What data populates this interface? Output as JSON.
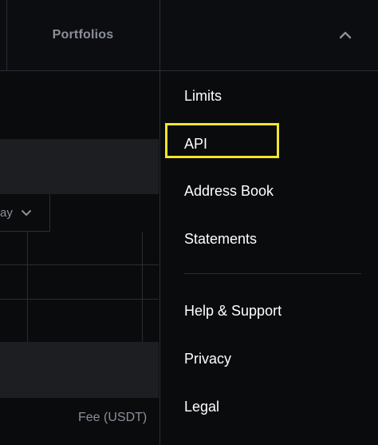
{
  "header": {
    "portfolios_label": "Portfolios",
    "menu_toggle_icon": "chevron-up-icon"
  },
  "background": {
    "period_select_value": "ay",
    "period_select_icon": "chevron-down-icon",
    "fee_label": "Fee (USDT)"
  },
  "menu": {
    "items": [
      {
        "label": "Limits"
      },
      {
        "label": "API",
        "highlighted": true
      },
      {
        "label": "Address Book"
      },
      {
        "label": "Statements"
      },
      {
        "label": "Help & Support"
      },
      {
        "label": "Privacy"
      },
      {
        "label": "Legal"
      }
    ],
    "highlight_color": "#f2e52c"
  },
  "colors": {
    "background": "#0a0b0d",
    "border": "#2a2d33",
    "muted_text": "#8a8f98",
    "menu_text": "#ffffff"
  }
}
